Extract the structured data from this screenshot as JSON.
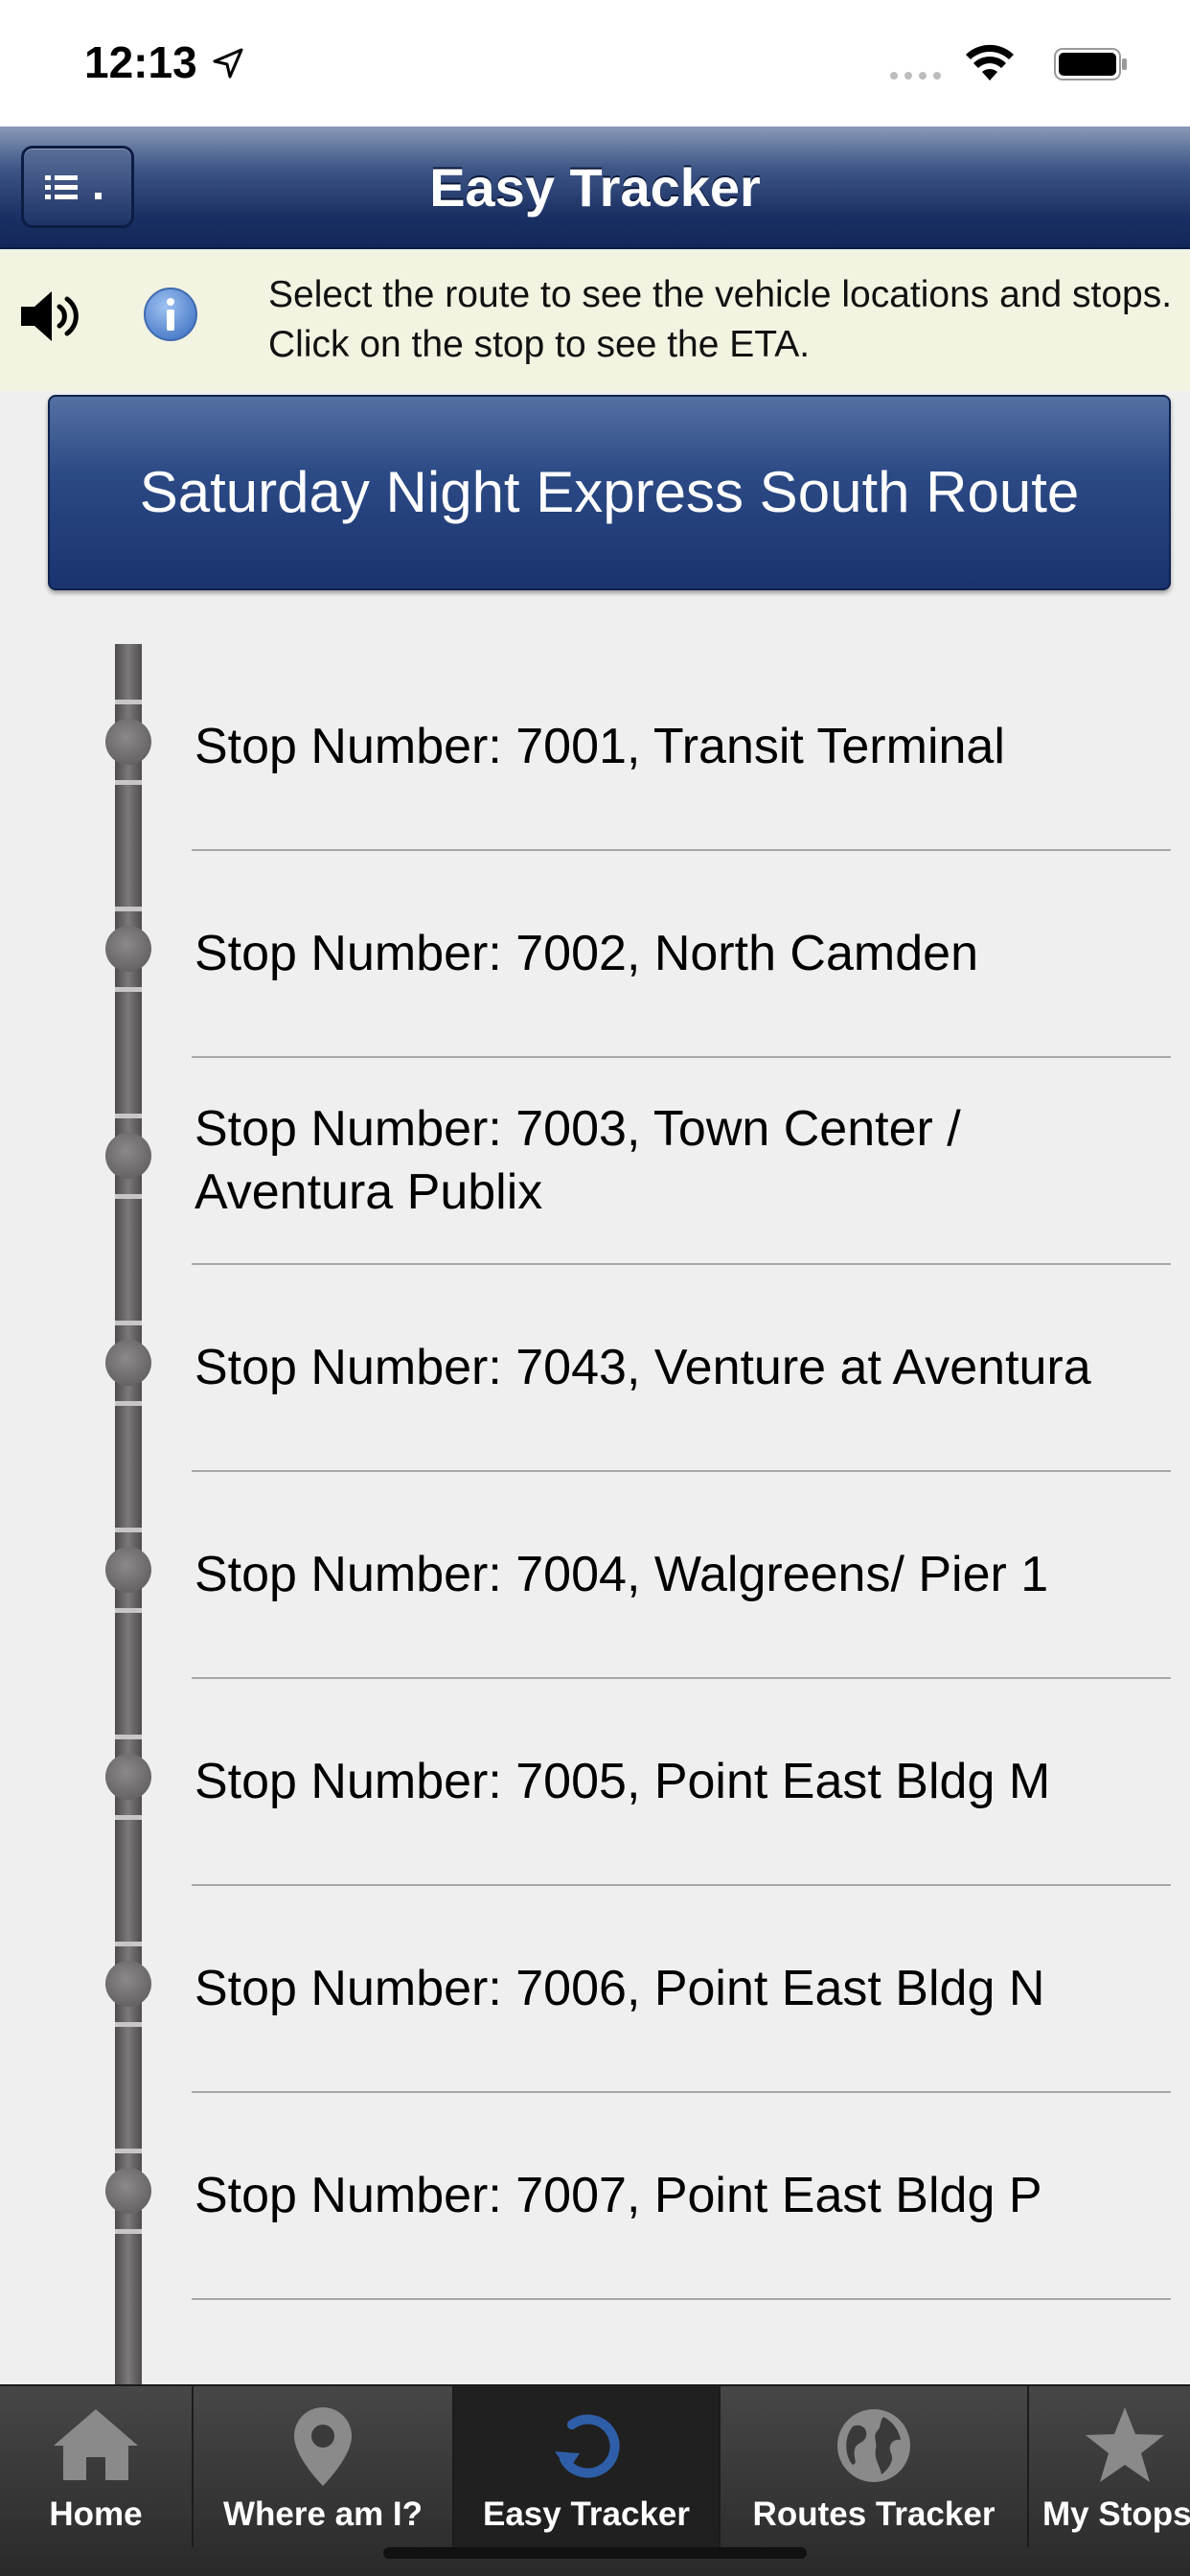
{
  "status_bar": {
    "time": "12:13",
    "icons": [
      "location-arrow-icon",
      "signal-dots-icon",
      "wifi-icon",
      "battery-icon"
    ]
  },
  "header": {
    "title": "Easy Tracker",
    "menu_icon": "list-menu-icon",
    "colors": {
      "header_dark": "#13275a",
      "header_light": "#8a9ab8"
    }
  },
  "info": {
    "icons": [
      "speaker-icon",
      "info-icon"
    ],
    "text": "Select the route to see the vehicle locations and stops. Click on the stop to see the ETA.",
    "background": "#f3f3e1"
  },
  "route": {
    "label": "Saturday Night Express South Route"
  },
  "stops": [
    {
      "label": "Stop Number: 7001, Transit Terminal"
    },
    {
      "label": "Stop Number: 7002, North Camden"
    },
    {
      "label": "Stop Number: 7003, Town Center / Aventura Publix"
    },
    {
      "label": "Stop Number: 7043, Venture at Aventura"
    },
    {
      "label": "Stop Number: 7004, Walgreens/ Pier 1"
    },
    {
      "label": "Stop Number: 7005, Point East Bldg M"
    },
    {
      "label": "Stop Number: 7006, Point East Bldg N"
    },
    {
      "label": "Stop Number: 7007, Point East Bldg P"
    }
  ],
  "tabs": [
    {
      "label": "Home",
      "icon": "home-icon",
      "active": false
    },
    {
      "label": "Where am I?",
      "icon": "map-pin-icon",
      "active": false
    },
    {
      "label": "Easy Tracker",
      "icon": "refresh-arrow-icon",
      "active": true
    },
    {
      "label": "Routes Tracker",
      "icon": "globe-icon",
      "active": false
    },
    {
      "label": "My Stops",
      "icon": "star-icon",
      "active": false
    }
  ]
}
